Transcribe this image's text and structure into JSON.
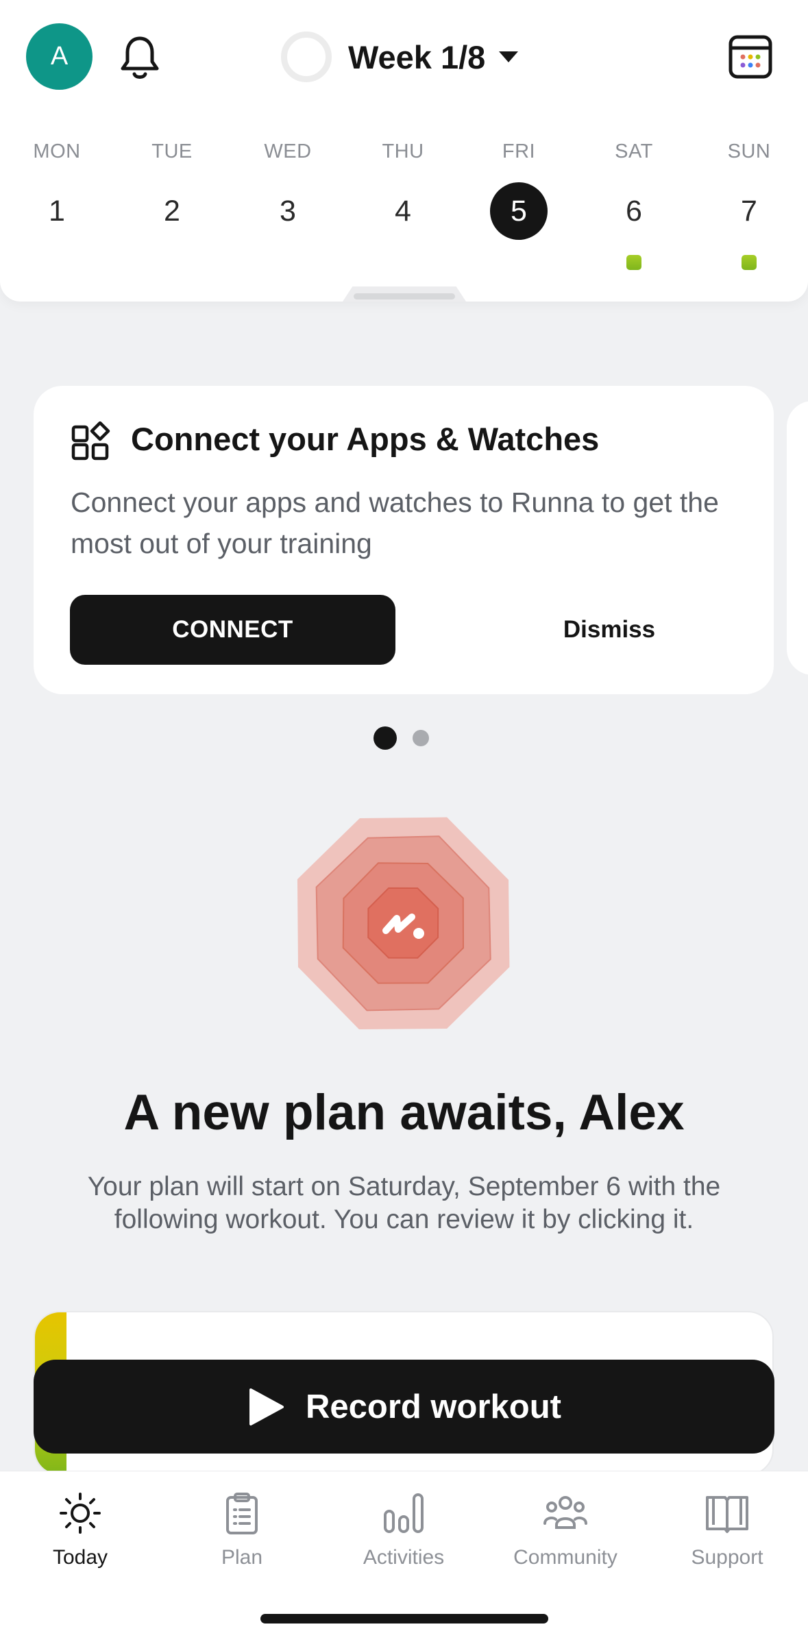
{
  "header": {
    "avatar_initial": "A",
    "week_title": "Week 1/8",
    "days": [
      {
        "name": "MON",
        "num": "1"
      },
      {
        "name": "TUE",
        "num": "2"
      },
      {
        "name": "WED",
        "num": "3"
      },
      {
        "name": "THU",
        "num": "4"
      },
      {
        "name": "FRI",
        "num": "5"
      },
      {
        "name": "SAT",
        "num": "6"
      },
      {
        "name": "SUN",
        "num": "7"
      }
    ],
    "selected_day": "5",
    "days_with_workouts": [
      "6",
      "7"
    ]
  },
  "connect_card": {
    "title": "Connect your Apps & Watches",
    "description": "Connect your apps and watches to Runna to get the most out of your training",
    "connect_label": "CONNECT",
    "dismiss_label": "Dismiss"
  },
  "carousel": {
    "pages": 2,
    "active_page": 1
  },
  "hero": {
    "title": "A new plan awaits, Alex",
    "text": "Your plan will start on Saturday, September 6 with the following workout. You can review it by clicking it."
  },
  "record_button": {
    "label": "Record workout"
  },
  "nav": {
    "today": "Today",
    "plan": "Plan",
    "activities": "Activities",
    "community": "Community",
    "support": "Support",
    "active": "today"
  },
  "colors": {
    "accent_dark": "#151515",
    "avatar": "#0e9688",
    "workout_dot": "#8fc21f",
    "hero_red": "#e07060"
  }
}
